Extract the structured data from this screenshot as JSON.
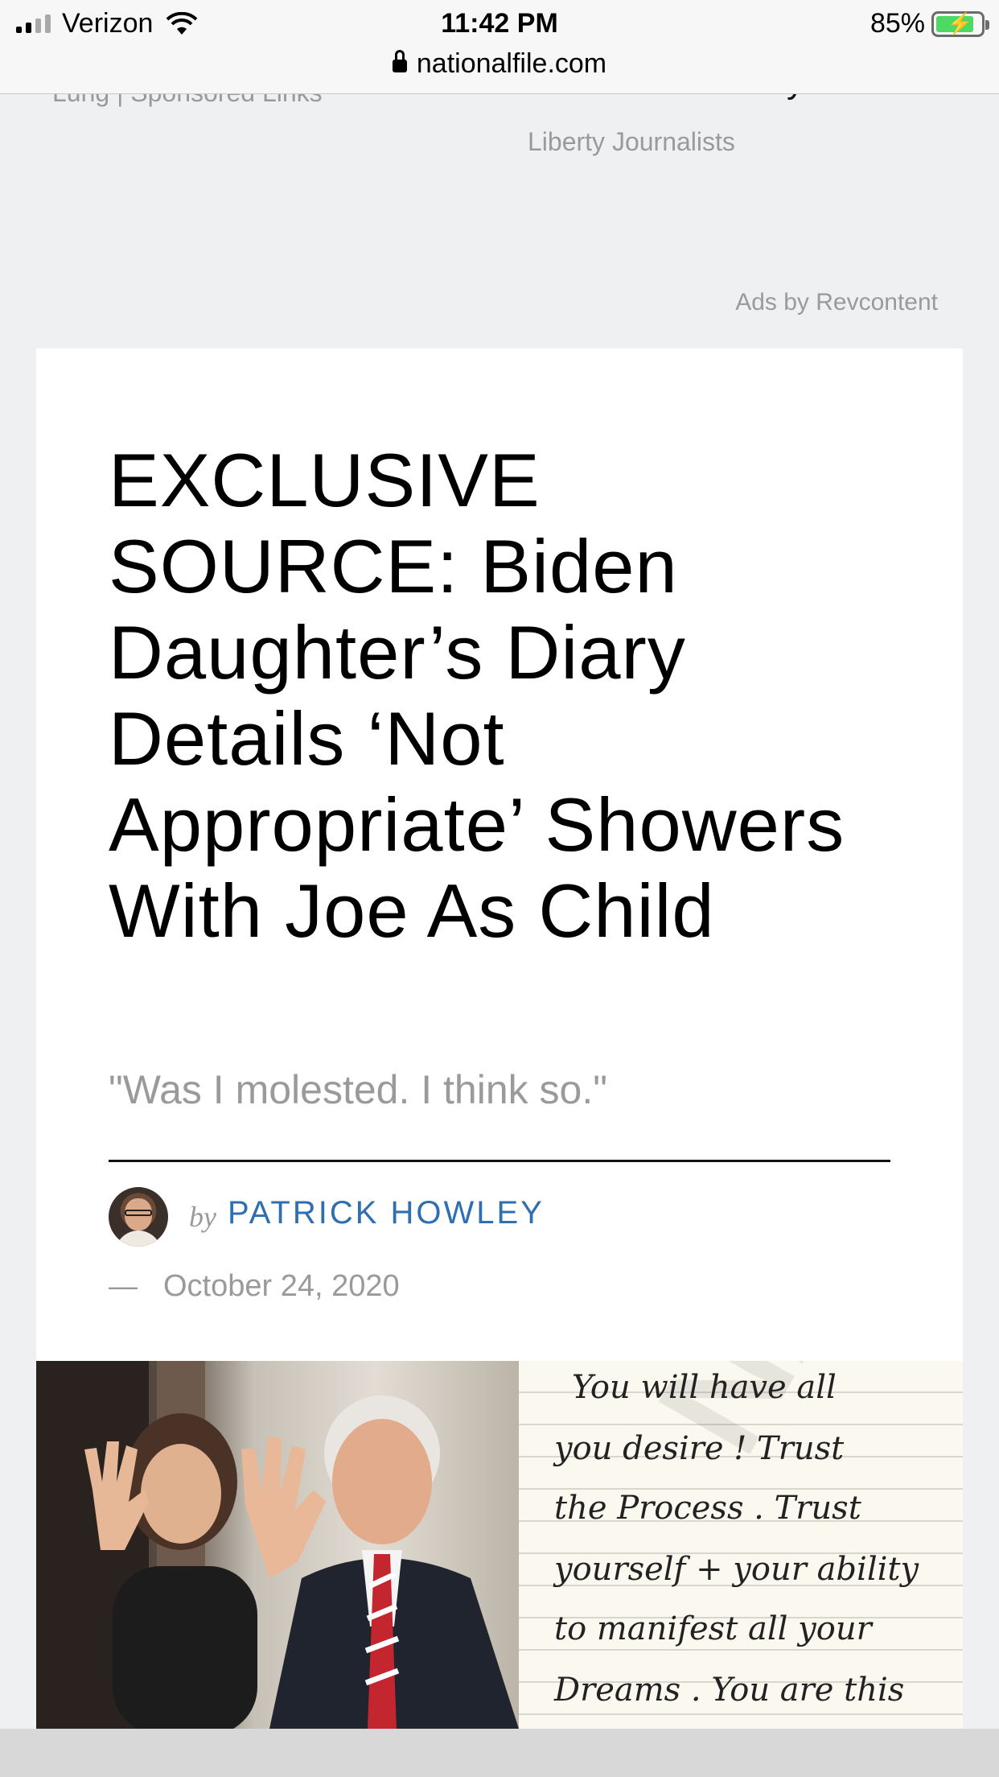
{
  "status_bar": {
    "carrier": "Verizon",
    "time": "11:42 PM",
    "battery_percent": "85%",
    "battery_level": 0.85,
    "url": "nationalfile.com",
    "icons": [
      "signal-icon",
      "wifi-icon",
      "battery-icon",
      "lock-icon"
    ]
  },
  "ads": {
    "left_item_text": "Lung | Sponsored Links",
    "right_item_title": "Claim Free Today",
    "right_item_source": "Liberty Journalists",
    "attribution": "Ads by Revcontent"
  },
  "article": {
    "headline": "EXCLUSIVE SOURCE: Biden Daughter’s Diary Details ‘Not Appropriate’ Showers With Joe As Child",
    "subtitle": "\"Was I molested. I think so.\"",
    "byline_prefix": "by",
    "author": "PATRICK HOWLEY",
    "date_dash": "—",
    "date": "October 24, 2020",
    "author_color": "#2f6fb0"
  },
  "diary_image": {
    "watermark": "NATIONAL",
    "lines": [
      "You will have all",
      "you desire ! Trust",
      "the Process . Trust",
      "yourself + your ability",
      "to manifest all your",
      "Dreams . You are this"
    ]
  }
}
